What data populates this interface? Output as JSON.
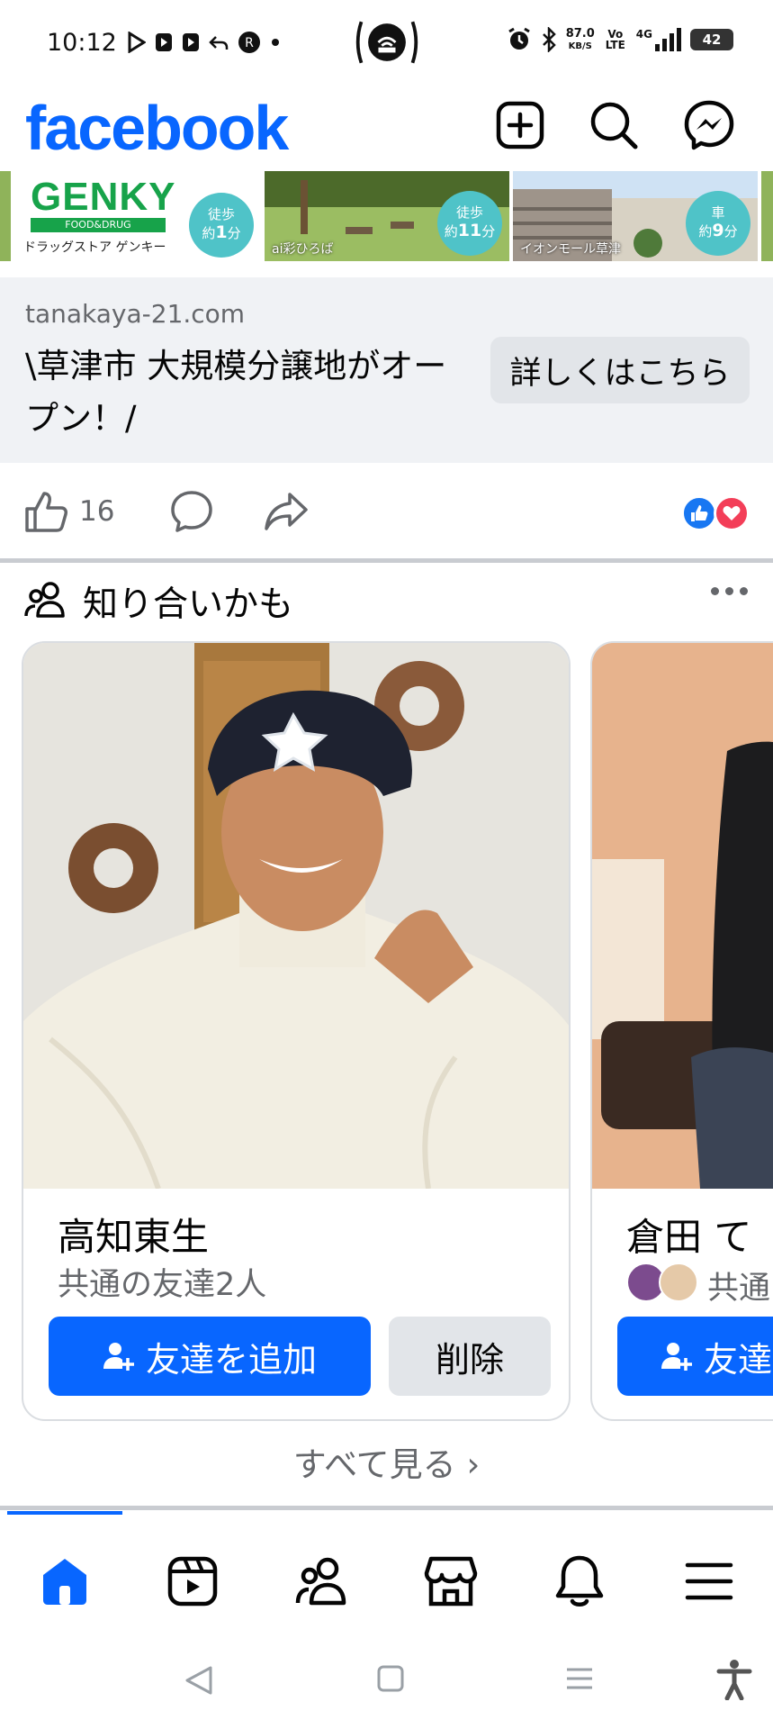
{
  "status_bar": {
    "time": "10:12",
    "network_speed": "87.0",
    "network_speed_unit": "KB/S",
    "volte": "Vo LTE",
    "network_type": "4G",
    "battery": "42"
  },
  "header": {
    "logo": "facebook"
  },
  "ads": [
    {
      "brand": "GENKY",
      "brand_sub": "FOOD&DRUG",
      "caption": "ドラッグストア ゲンキー",
      "badge_top": "徒歩",
      "badge_prefix": "約",
      "badge_num": "1",
      "badge_unit": "分"
    },
    {
      "caption": "ai彩ひろば",
      "badge_top": "徒歩",
      "badge_prefix": "約",
      "badge_num": "11",
      "badge_unit": "分"
    },
    {
      "caption": "イオンモール草津",
      "badge_top": "車",
      "badge_prefix": "約",
      "badge_num": "9",
      "badge_unit": "分"
    }
  ],
  "link_preview": {
    "domain": "tanakaya-21.com",
    "headline": "\\草津市 大規模分譲地がオープン！/",
    "cta": "詳しくはこちら"
  },
  "post_actions": {
    "like_count": "16"
  },
  "pymk": {
    "title": "知り合いかも",
    "cards": [
      {
        "name": "高知東生",
        "mutual": "共通の友達2人",
        "add_label": "友達を追加",
        "remove_label": "削除"
      },
      {
        "name": "倉田 て",
        "mutual": "共通",
        "add_label": "友達"
      }
    ],
    "see_all": "すべて見る ›"
  },
  "colors": {
    "brand": "#0866ff",
    "secondary_text": "#65676b",
    "button_gray": "#e2e5e9",
    "love": "#f33e58"
  },
  "bottom_nav": {
    "items": [
      "home-icon",
      "video-icon",
      "friends-icon",
      "marketplace-icon",
      "notifications-icon",
      "menu-icon"
    ],
    "active": "home-icon"
  }
}
